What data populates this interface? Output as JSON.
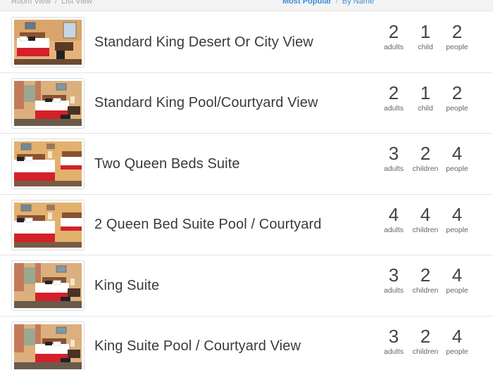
{
  "topbar": {
    "room_view": "Room View",
    "list_view": "List View",
    "most_popular": "Most Popular",
    "by_name": "By Name",
    "separator": "/"
  },
  "rooms": [
    {
      "name": "Standard King Desert Or City View",
      "thumb": "king-desert",
      "adults": "2",
      "adults_label": "adults",
      "children": "1",
      "children_label": "child",
      "people": "2",
      "people_label": "people"
    },
    {
      "name": "Standard King Pool/Courtyard View",
      "thumb": "king-pool",
      "adults": "2",
      "adults_label": "adults",
      "children": "1",
      "children_label": "child",
      "people": "2",
      "people_label": "people"
    },
    {
      "name": "Two Queen Beds Suite",
      "thumb": "queen",
      "adults": "3",
      "adults_label": "adults",
      "children": "2",
      "children_label": "children",
      "people": "4",
      "people_label": "people"
    },
    {
      "name": "2 Queen Bed Suite Pool / Courtyard",
      "thumb": "queen",
      "adults": "4",
      "adults_label": "adults",
      "children": "4",
      "children_label": "children",
      "people": "4",
      "people_label": "people"
    },
    {
      "name": "King Suite",
      "thumb": "king-pool",
      "adults": "3",
      "adults_label": "adults",
      "children": "2",
      "children_label": "children",
      "people": "4",
      "people_label": "people"
    },
    {
      "name": "King Suite Pool / Courtyard View",
      "thumb": "king-pool",
      "adults": "3",
      "adults_label": "adults",
      "children": "2",
      "children_label": "children",
      "people": "4",
      "people_label": "people"
    }
  ]
}
